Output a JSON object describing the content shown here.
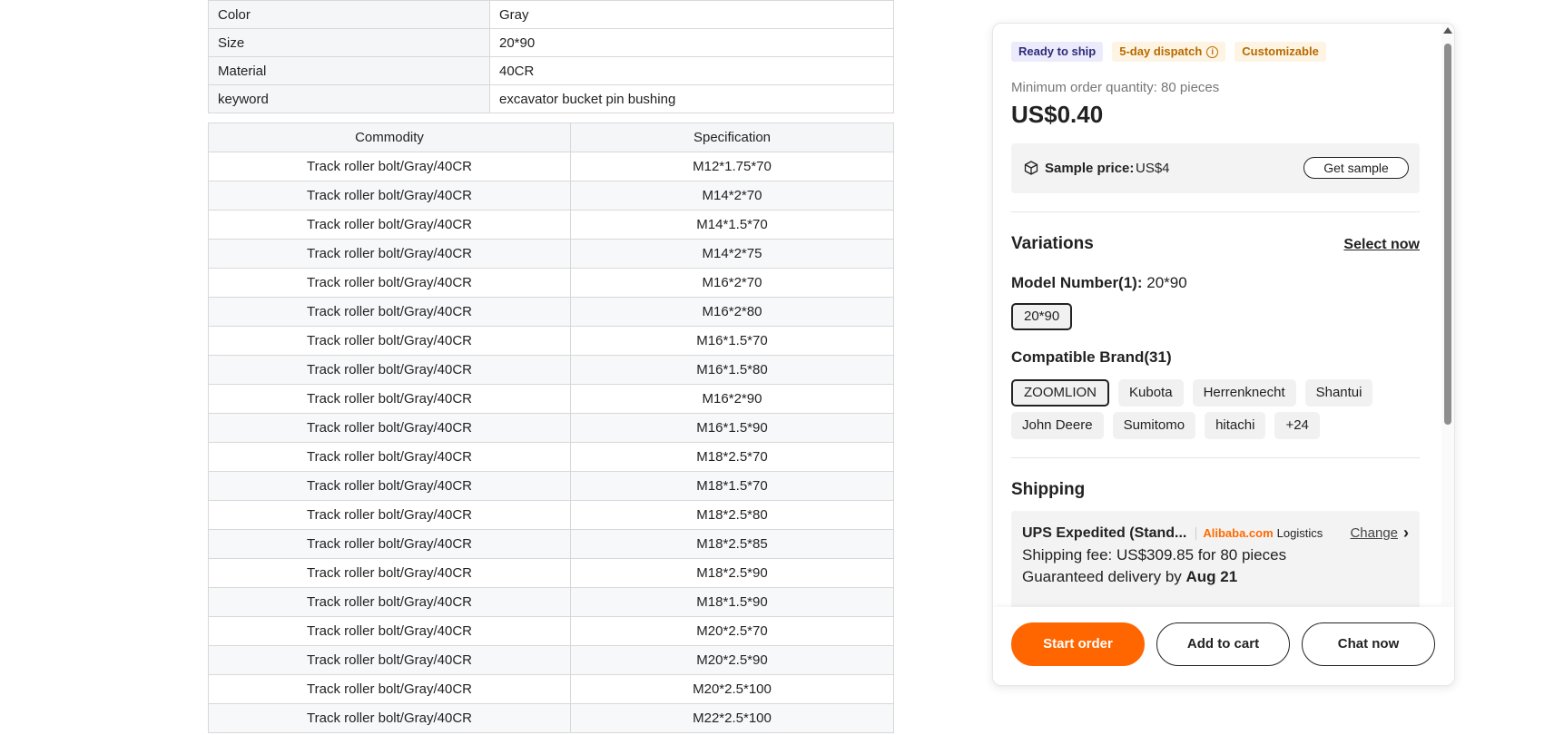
{
  "attributes": [
    {
      "key": "Color",
      "value": "Gray"
    },
    {
      "key": "Size",
      "value": "20*90"
    },
    {
      "key": "Material",
      "value": "40CR"
    },
    {
      "key": "keyword",
      "value": "excavator bucket pin bushing"
    }
  ],
  "spec_table": {
    "headers": [
      "Commodity",
      "Specification"
    ],
    "rows": [
      [
        "Track roller bolt/Gray/40CR",
        "M12*1.75*70"
      ],
      [
        "Track roller bolt/Gray/40CR",
        "M14*2*70"
      ],
      [
        "Track roller bolt/Gray/40CR",
        "M14*1.5*70"
      ],
      [
        "Track roller bolt/Gray/40CR",
        "M14*2*75"
      ],
      [
        "Track roller bolt/Gray/40CR",
        "M16*2*70"
      ],
      [
        "Track roller bolt/Gray/40CR",
        "M16*2*80"
      ],
      [
        "Track roller bolt/Gray/40CR",
        "M16*1.5*70"
      ],
      [
        "Track roller bolt/Gray/40CR",
        "M16*1.5*80"
      ],
      [
        "Track roller bolt/Gray/40CR",
        "M16*2*90"
      ],
      [
        "Track roller bolt/Gray/40CR",
        "M16*1.5*90"
      ],
      [
        "Track roller bolt/Gray/40CR",
        "M18*2.5*70"
      ],
      [
        "Track roller bolt/Gray/40CR",
        "M18*1.5*70"
      ],
      [
        "Track roller bolt/Gray/40CR",
        "M18*2.5*80"
      ],
      [
        "Track roller bolt/Gray/40CR",
        "M18*2.5*85"
      ],
      [
        "Track roller bolt/Gray/40CR",
        "M18*2.5*90"
      ],
      [
        "Track roller bolt/Gray/40CR",
        "M18*1.5*90"
      ],
      [
        "Track roller bolt/Gray/40CR",
        "M20*2.5*70"
      ],
      [
        "Track roller bolt/Gray/40CR",
        "M20*2.5*90"
      ],
      [
        "Track roller bolt/Gray/40CR",
        "M20*2.5*100"
      ],
      [
        "Track roller bolt/Gray/40CR",
        "M22*2.5*100"
      ]
    ]
  },
  "panel": {
    "badges": {
      "ready": "Ready to ship",
      "dispatch": "5-day dispatch",
      "customizable": "Customizable"
    },
    "moq": "Minimum order quantity: 80 pieces",
    "price": "US$0.40",
    "sample": {
      "icon": "box-icon",
      "label": "Sample price:",
      "value": "US$4",
      "button": "Get sample"
    },
    "variations": {
      "title": "Variations",
      "select_now": "Select now",
      "model_label": "Model Number(1):",
      "model_value": "20*90",
      "model_options": [
        "20*90"
      ],
      "brand_label": "Compatible Brand(31)",
      "brands": [
        "ZOOMLION",
        "Kubota",
        "Herrenknecht",
        "Shantui",
        "John Deere",
        "Sumitomo",
        "hitachi",
        "+24"
      ]
    },
    "shipping": {
      "title": "Shipping",
      "method": "UPS Expedited (Stand...",
      "brand_alibaba": "Alibaba.com",
      "brand_logistics": "Logistics",
      "change": "Change",
      "fee": "Shipping fee: US$309.85 for 80 pieces",
      "delivery_prefix": "Guaranteed delivery by",
      "delivery_date": "Aug 21"
    },
    "actions": {
      "start_order": "Start order",
      "add_to_cart": "Add to cart",
      "chat_now": "Chat now"
    }
  },
  "colors": {
    "accent": "#ff6600",
    "alibaba_orange": "#ff6a00",
    "ready_badge_bg": "#ecebfb",
    "dispatch_badge_text": "#b86a00"
  }
}
